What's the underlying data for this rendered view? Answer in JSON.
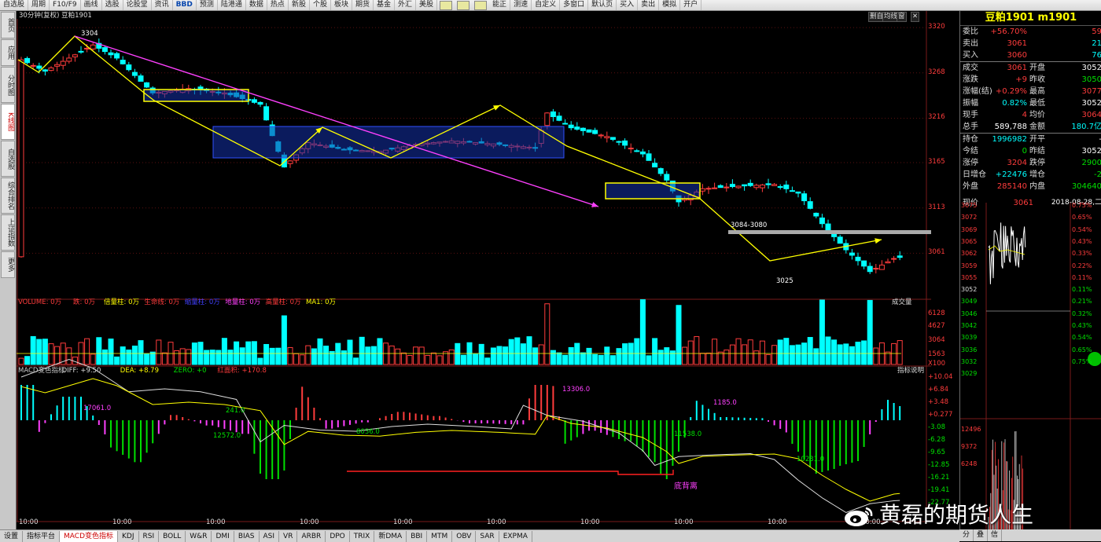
{
  "toolbar": {
    "items": [
      "自选股",
      "周期",
      "F10/F9",
      "画线",
      "选股",
      "论股堂",
      "资讯",
      "BBD",
      "预测",
      "陆港通",
      "数据",
      "热点",
      "新股",
      "个股",
      "板块",
      "期货",
      "基金",
      "外汇",
      "美股",
      "",
      "",
      "",
      "能正",
      "测速",
      "自定义",
      "多窗口",
      "默认页",
      "买入",
      "卖出",
      "模拟",
      "开户"
    ]
  },
  "leftnav": {
    "items": [
      "首页",
      "应用",
      "分时图",
      "K线图",
      "自选股",
      "综合排名",
      "上证指数",
      "更多"
    ],
    "active_index": 3
  },
  "chart": {
    "header_left": "30分钟(复权)  豆粕1901",
    "header_right": [
      "删自选",
      "均线",
      "窗",
      "✕"
    ],
    "price_ticks": [
      "3320",
      "3268",
      "3216",
      "3165",
      "3113",
      "3061"
    ],
    "high_label": "3304",
    "low_label": "3025",
    "resistance_label": "3084-3080",
    "volume_header": [
      {
        "text": "VOLUME: 0万",
        "color": "#ff3c3c"
      },
      {
        "text": "跌: 0万",
        "color": "#ff3c3c"
      },
      {
        "text": "倍量柱: 0万",
        "color": "#ffff00"
      },
      {
        "text": "生命线: 0万",
        "color": "#ff3c3c"
      },
      {
        "text": "缩量柱: 0万",
        "color": "#4040ff"
      },
      {
        "text": "地量柱: 0万",
        "color": "#ff40ff"
      },
      {
        "text": "高量柱: 0万",
        "color": "#ff3c3c"
      },
      {
        "text": "MA1: 0万",
        "color": "#ffff00"
      }
    ],
    "volume_dropdown": "成交量",
    "volume_ticks": [
      "6128",
      "4627",
      "3064",
      "1563",
      "X100"
    ],
    "macd_header": [
      {
        "text": "MACD变色指标",
        "color": "#ccc"
      },
      {
        "text": "DIFF: +9.50",
        "color": "#ddd"
      },
      {
        "text": "DEA: +8.79",
        "color": "#ffff00"
      },
      {
        "text": "ZERO: +0",
        "color": "#00e000"
      },
      {
        "text": "红面积: +170.8",
        "color": "#ff3c3c"
      }
    ],
    "macd_help": "指标说明",
    "macd_ticks": [
      "+10.04",
      "+6.84",
      "+3.48",
      "+0.277",
      "-3.08",
      "-6.28",
      "-9.65",
      "-12.85",
      "-16.21",
      "-19.41",
      "-22.77"
    ],
    "macd_annotations": [
      {
        "text": "17061.0",
        "color": "#ff40ff"
      },
      {
        "text": "241.0",
        "color": "#00e000"
      },
      {
        "text": "12572.0",
        "color": "#00e000"
      },
      {
        "text": "8036.0",
        "color": "#00e000"
      },
      {
        "text": "13306.0",
        "color": "#ff40ff"
      },
      {
        "text": "11538.0",
        "color": "#00e000"
      },
      {
        "text": "1185.0",
        "color": "#ff40ff"
      },
      {
        "text": "10231.0",
        "color": "#00e000"
      }
    ],
    "divergence_label": "底背离",
    "time_labels": [
      "10:00",
      "10:00",
      "10:00",
      "10:00",
      "10:00",
      "10:00",
      "10:00",
      "10:00",
      "10:00",
      "10:00"
    ]
  },
  "bottom_tabs": [
    "设置",
    "指标平台",
    "MACD变色指标",
    "KDJ",
    "RSI",
    "BOLL",
    "W&R",
    "DMI",
    "BIAS",
    "ASI",
    "VR",
    "ARBR",
    "DPO",
    "TRIX",
    "新DMA",
    "BBI",
    "MTM",
    "OBV",
    "SAR",
    "EXPMA"
  ],
  "bottom_active": 2,
  "panel": {
    "title": "豆粕1901  m1901",
    "rows": [
      {
        "l1": "委比",
        "v1": "+56.70%",
        "c1": "red",
        "l2": "",
        "v2": "59",
        "c2": "red"
      },
      {
        "l1": "卖出",
        "v1": "3061",
        "c1": "red",
        "l2": "",
        "v2": "21",
        "c2": "cyan"
      },
      {
        "l1": "买入",
        "v1": "3060",
        "c1": "red",
        "l2": "",
        "v2": "76",
        "c2": "cyan"
      },
      {
        "l1": "成交",
        "v1": "3061",
        "c1": "red",
        "l2": "开盘",
        "v2": "3052",
        "c2": "white"
      },
      {
        "l1": "涨跌",
        "v1": "+9",
        "c1": "red",
        "l2": "昨收",
        "v2": "3050",
        "c2": "green"
      },
      {
        "l1": "涨幅(结)",
        "v1": "+0.29%",
        "c1": "red",
        "l2": "最高",
        "v2": "3077",
        "c2": "red"
      },
      {
        "l1": "振幅",
        "v1": "0.82%",
        "c1": "cyan",
        "l2": "最低",
        "v2": "3052",
        "c2": "white"
      },
      {
        "l1": "现手",
        "v1": "4",
        "c1": "red",
        "l2": "均价",
        "v2": "3064",
        "c2": "red"
      },
      {
        "l1": "总手",
        "v1": "589,788",
        "c1": "white",
        "l2": "金额",
        "v2": "180.7亿",
        "c2": "cyan"
      },
      {
        "l1": "持仓",
        "v1": "1996982",
        "c1": "cyan",
        "l2": "开平",
        "v2": "-",
        "c2": "white"
      },
      {
        "l1": "今结",
        "v1": "0",
        "c1": "green",
        "l2": "昨结",
        "v2": "3052",
        "c2": "white"
      },
      {
        "l1": "涨停",
        "v1": "3204",
        "c1": "red",
        "l2": "跌停",
        "v2": "2900",
        "c2": "green"
      },
      {
        "l1": "日增仓",
        "v1": "+22476",
        "c1": "cyan",
        "l2": "增仓",
        "v2": "-2",
        "c2": "green"
      },
      {
        "l1": "外盘",
        "v1": "285140",
        "c1": "red",
        "l2": "内盘",
        "v2": "304640",
        "c2": "green"
      }
    ],
    "current_label": "现价",
    "current_price": "3061",
    "current_time": "2018-08-28,二",
    "mini_left": [
      "3075",
      "3072",
      "3069",
      "3065",
      "3062",
      "3059",
      "3055",
      "3052",
      "3049",
      "3046",
      "3042",
      "3039",
      "3036",
      "3032",
      "3029",
      "12496",
      "9372",
      "6248"
    ],
    "mini_right": [
      "0.75%",
      "0.65%",
      "0.54%",
      "0.43%",
      "0.33%",
      "0.22%",
      "0.11%",
      "0.11%",
      "0.21%",
      "0.32%",
      "0.43%",
      "0.54%",
      "0.65%",
      "0.75%"
    ],
    "tabs": [
      "分",
      "叠",
      "信"
    ]
  },
  "watermark": "黄磊的期货人生"
}
